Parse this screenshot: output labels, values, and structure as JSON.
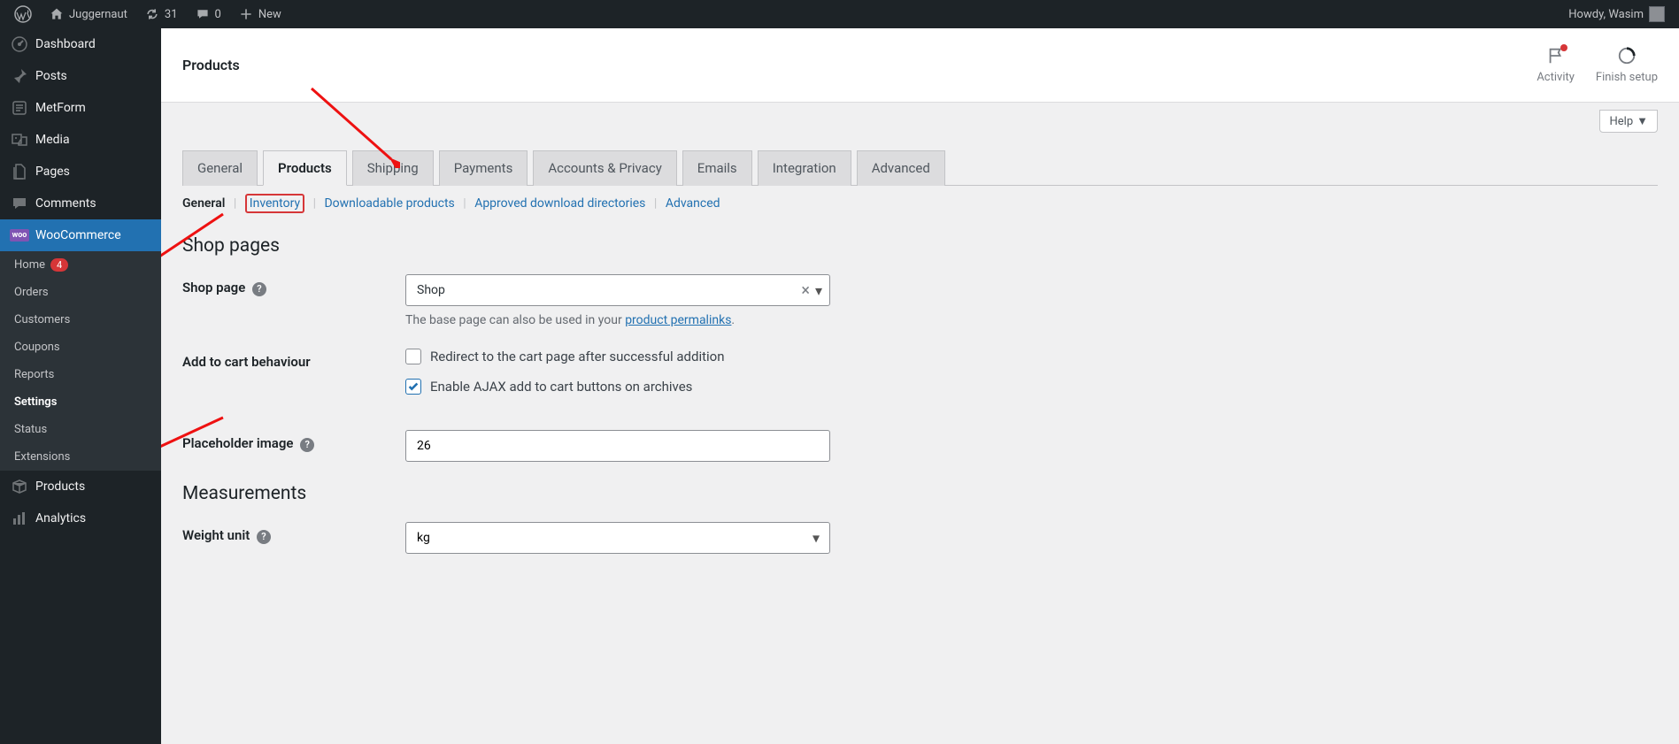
{
  "adminbar": {
    "site_name": "Juggernaut",
    "updates_count": "31",
    "comments_count": "0",
    "new_label": "New",
    "greeting": "Howdy, Wasim"
  },
  "sidebar": {
    "items": [
      {
        "label": "Dashboard",
        "icon": "dashboard"
      },
      {
        "label": "Posts",
        "icon": "pin"
      },
      {
        "label": "MetForm",
        "icon": "form"
      },
      {
        "label": "Media",
        "icon": "media"
      },
      {
        "label": "Pages",
        "icon": "pages"
      },
      {
        "label": "Comments",
        "icon": "comment"
      },
      {
        "label": "WooCommerce",
        "icon": "woo",
        "active": true
      },
      {
        "label": "Products",
        "icon": "box"
      },
      {
        "label": "Analytics",
        "icon": "bars"
      }
    ],
    "submenu": [
      {
        "label": "Home",
        "badge": "4"
      },
      {
        "label": "Orders"
      },
      {
        "label": "Customers"
      },
      {
        "label": "Coupons"
      },
      {
        "label": "Reports"
      },
      {
        "label": "Settings",
        "active": true
      },
      {
        "label": "Status"
      },
      {
        "label": "Extensions"
      }
    ]
  },
  "header": {
    "title": "Products",
    "activity": "Activity",
    "finish_setup": "Finish setup",
    "help": "Help"
  },
  "tabs": [
    {
      "label": "General"
    },
    {
      "label": "Products",
      "active": true
    },
    {
      "label": "Shipping"
    },
    {
      "label": "Payments"
    },
    {
      "label": "Accounts & Privacy"
    },
    {
      "label": "Emails"
    },
    {
      "label": "Integration"
    },
    {
      "label": "Advanced"
    }
  ],
  "subtabs": [
    {
      "label": "General",
      "active": true
    },
    {
      "label": "Inventory",
      "highlighted": true
    },
    {
      "label": "Downloadable products"
    },
    {
      "label": "Approved download directories"
    },
    {
      "label": "Advanced"
    }
  ],
  "sections": {
    "shop_pages_title": "Shop pages",
    "shop_page_label": "Shop page",
    "shop_page_value": "Shop",
    "shop_page_help_pre": "The base page can also be used in your ",
    "shop_page_help_link": "product permalinks",
    "shop_page_help_post": ".",
    "cart_label": "Add to cart behaviour",
    "cart_cb1": "Redirect to the cart page after successful addition",
    "cart_cb2": "Enable AJAX add to cart buttons on archives",
    "placeholder_label": "Placeholder image",
    "placeholder_value": "26",
    "measurements_title": "Measurements",
    "weight_label": "Weight unit",
    "weight_value": "kg"
  }
}
